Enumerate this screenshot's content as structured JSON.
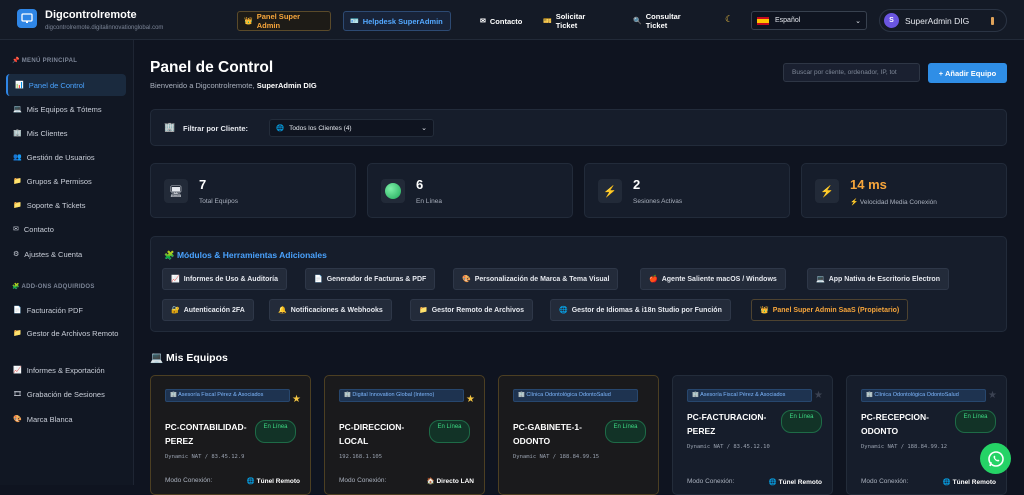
{
  "app": {
    "title": "Digcontrolremote",
    "subtitle": "digcontrolremote.digitalinnovationglobal.com"
  },
  "topbar": {
    "super_admin": "Panel Super Admin",
    "helpdesk": "Helpdesk SuperAdmin",
    "contact": "Contacto",
    "ticket": "Solicitar Ticket",
    "consult": "Consultar Ticket",
    "language": "Español",
    "user_initial": "S",
    "user_name": "SuperAdmin DIG"
  },
  "sidebar": {
    "section_main": "MENÚ PRINCIPAL",
    "items": [
      {
        "label": "Panel de Control"
      },
      {
        "label": "Mis Equipos & Tótems"
      },
      {
        "label": "Mis Clientes"
      },
      {
        "label": "Gestión de Usuarios"
      },
      {
        "label": "Grupos & Permisos"
      },
      {
        "label": "Soporte & Tickets"
      },
      {
        "label": "Contacto"
      },
      {
        "label": "Ajustes & Cuenta"
      }
    ],
    "section_addons": "ADD-ONS ADQUIRIDOS",
    "addons": [
      {
        "label": "Facturación PDF"
      },
      {
        "label": "Gestor de Archivos Remoto"
      },
      {
        "label": "Informes & Exportación"
      },
      {
        "label": "Grabación de Sesiones"
      },
      {
        "label": "Marca Blanca"
      }
    ]
  },
  "header": {
    "title": "Panel de Control",
    "welcome": "Bienvenido a Digcontrolremote,",
    "welcome_user": "SuperAdmin DIG",
    "search_placeholder": "Buscar por cliente, ordenador, IP, tot",
    "add_button": "+ Añadir Equipo"
  },
  "filter": {
    "label": "Filtrar por Cliente:",
    "selected": "Todos los Clientes (4)"
  },
  "stats": [
    {
      "value": "7",
      "label": "Total Equipos",
      "icon": "monitor-icon"
    },
    {
      "value": "6",
      "label": "En Línea",
      "icon": "green-dot-icon"
    },
    {
      "value": "2",
      "label": "Sesiones Activas",
      "icon": "lightning-icon"
    },
    {
      "value": "14 ms",
      "label": "Velocidad Media Conexión",
      "icon": "lightning-icon"
    }
  ],
  "tools": {
    "title": "Módulos & Herramientas Adicionales",
    "chips": [
      "Informes de Uso & Auditoría",
      "Generador de Facturas & PDF",
      "Personalización de Marca & Tema Visual",
      "Agente Saliente macOS / Windows",
      "App Nativa de Escritorio Electron",
      "Autenticación 2FA",
      "Notificaciones & Webhooks",
      "Gestor Remoto de Archivos",
      "Gestor de Idiomas & i18n Studio por Función",
      "Panel Super Admin SaaS (Propietario)"
    ]
  },
  "equipment": {
    "title": "Mis Equipos",
    "mode_label": "Modo Conexión:",
    "online": "En Línea",
    "cards": [
      {
        "client": "Asesoría Fiscal Pérez & Asociados",
        "name": "PC-CONTABILIDAD-PEREZ",
        "ip": "Dynamic NAT / 83.45.12.9",
        "mode": "Túnel Remoto",
        "fav": true
      },
      {
        "client": "Digital Innovation Global (Interno)",
        "name": "PC-DIRECCION-LOCAL",
        "ip": "192.168.1.105",
        "mode": "Directo LAN",
        "fav": true
      },
      {
        "client": "Clínica Odontológica OdontoSalud",
        "name": "PC-GABINETE-1-ODONTO",
        "ip": "Dynamic NAT / 188.84.99.15",
        "mode": "",
        "fav": false
      },
      {
        "client": "Asesoría Fiscal Pérez & Asociados",
        "name": "PC-FACTURACION-PEREZ",
        "ip": "Dynamic NAT / 83.45.12.10",
        "mode": "Túnel Remoto",
        "fav": false
      },
      {
        "client": "Clínica Odontológica OdontoSalud",
        "name": "PC-RECEPCION-ODONTO",
        "ip": "Dynamic NAT / 188.84.99.12",
        "mode": "Túnel Remoto",
        "fav": false
      }
    ]
  }
}
